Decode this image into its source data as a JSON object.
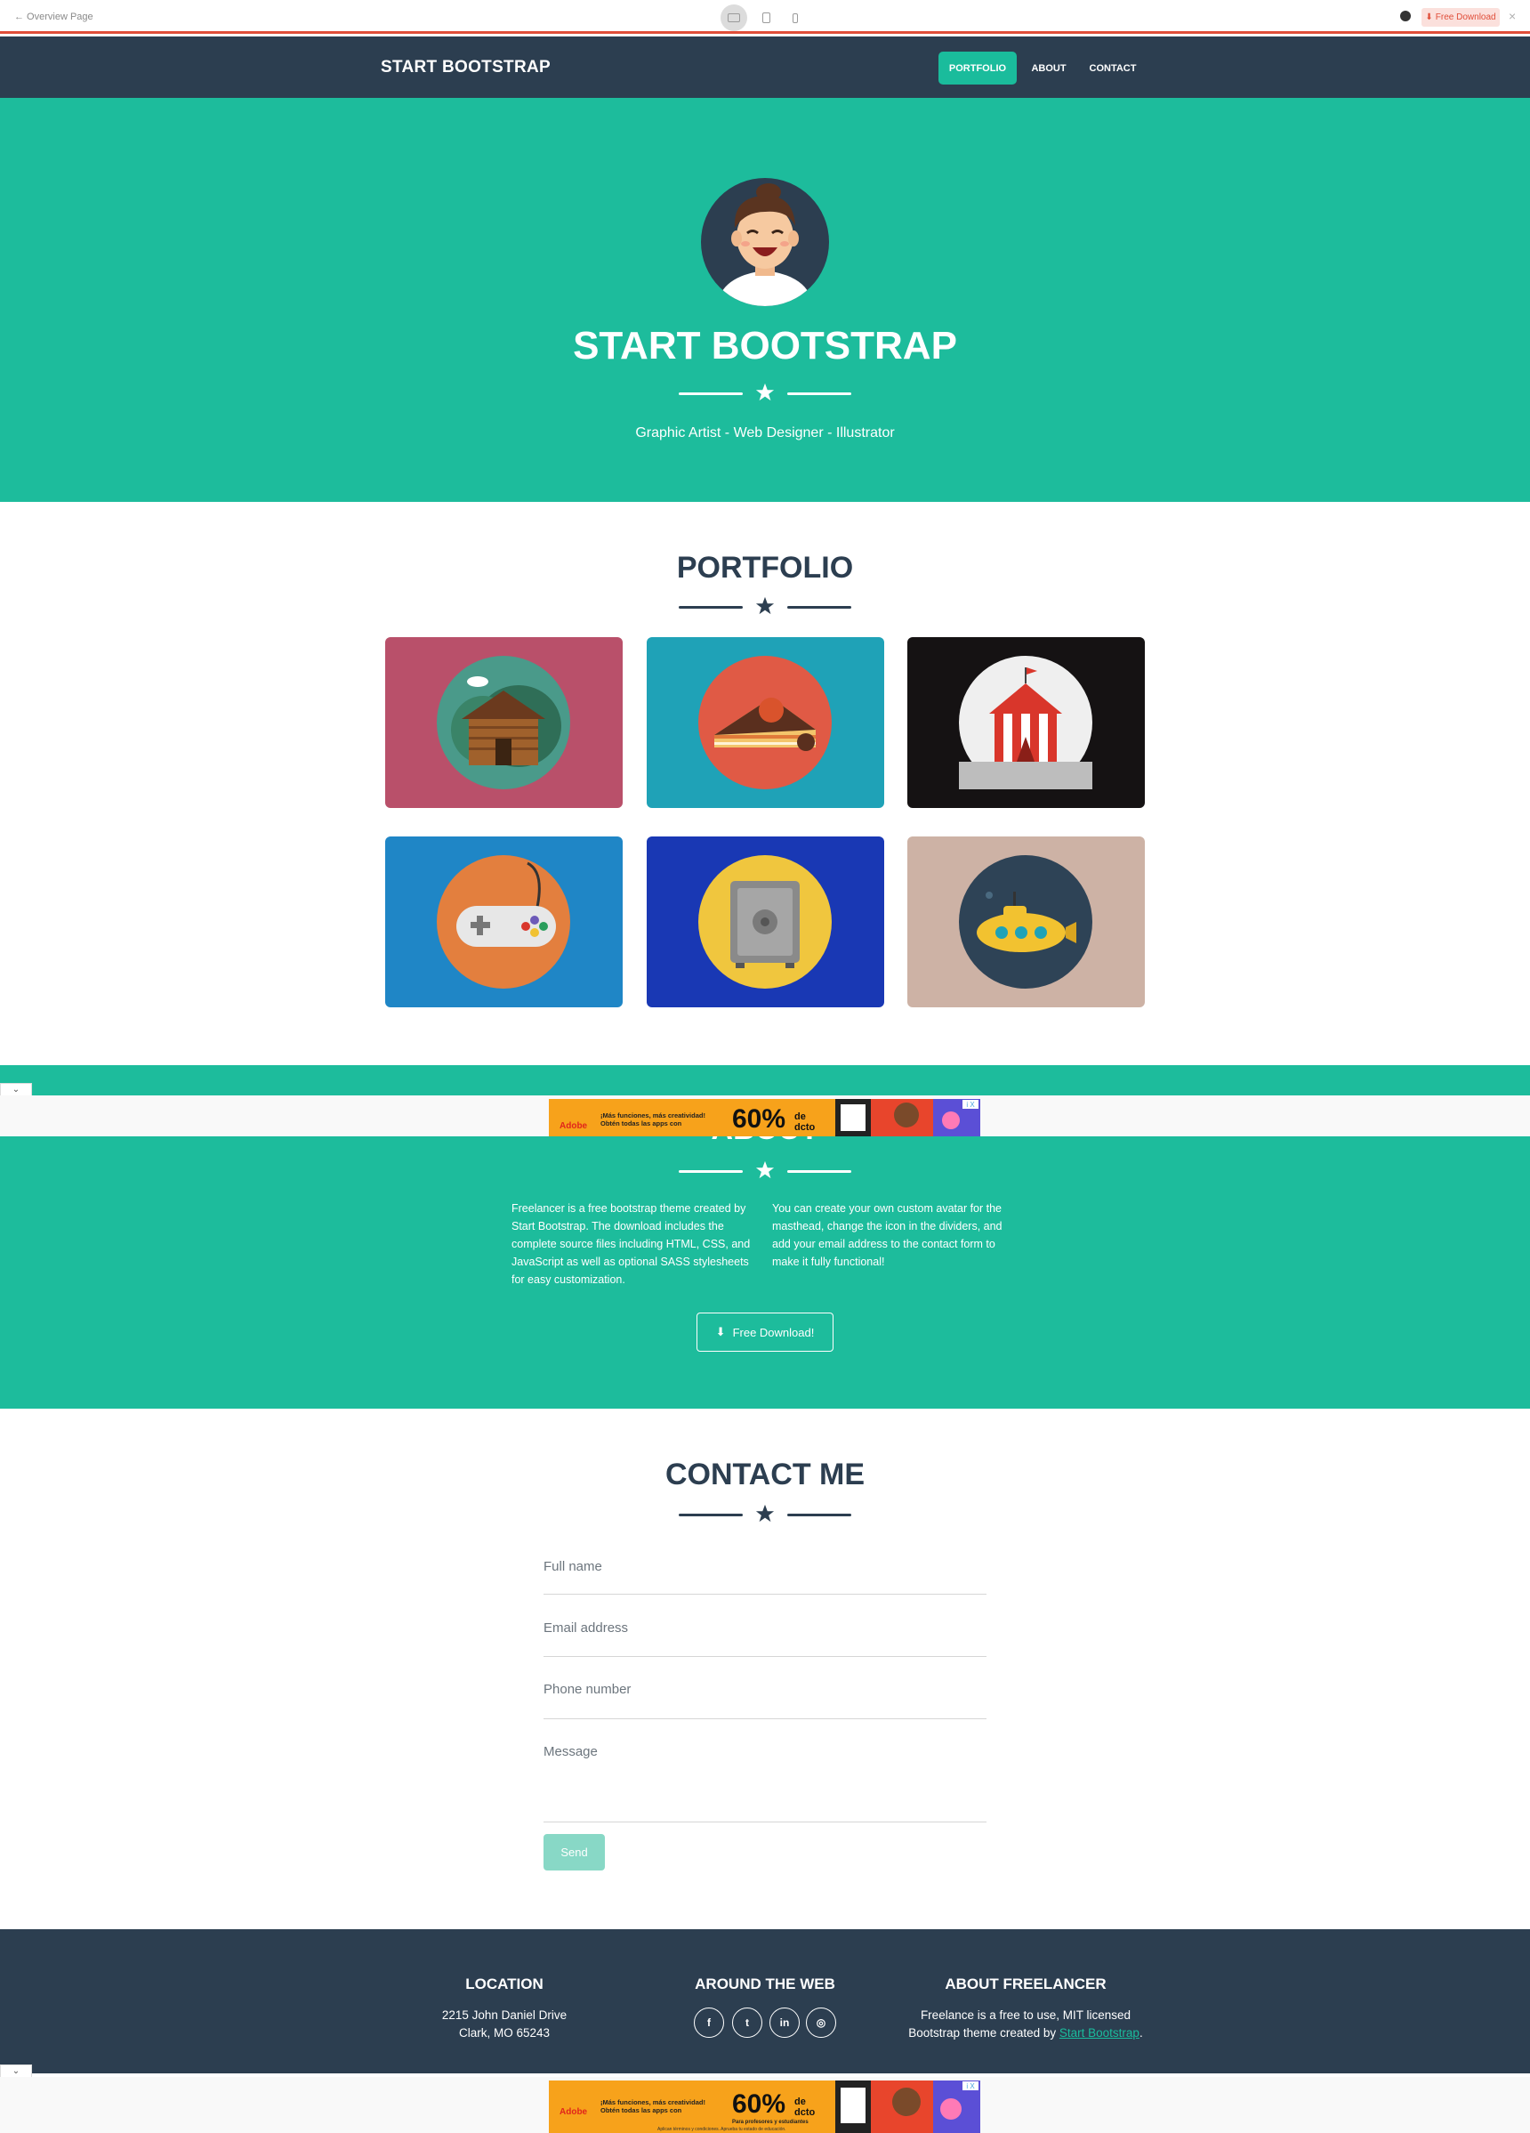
{
  "preview_bar": {
    "back_label": "← Overview Page",
    "download_label": "Free Download",
    "close_label": "×"
  },
  "navbar": {
    "brand": "START BOOTSTRAP",
    "items": [
      {
        "label": "PORTFOLIO",
        "active": true
      },
      {
        "label": "ABOUT",
        "active": false
      },
      {
        "label": "CONTACT",
        "active": false
      }
    ]
  },
  "masthead": {
    "title": "START BOOTSTRAP",
    "subtitle": "Graphic Artist - Web Designer - Illustrator"
  },
  "portfolio": {
    "title": "PORTFOLIO",
    "items": [
      {
        "name": "cabin",
        "bg": "#b9506a",
        "circle": "#4a9a8a"
      },
      {
        "name": "cake",
        "bg": "#1fa2b7",
        "circle": "#e05a45"
      },
      {
        "name": "circus",
        "bg": "#151213",
        "circle": "#efefef"
      },
      {
        "name": "game",
        "bg": "#1f86c6",
        "circle": "#e37f3e"
      },
      {
        "name": "safe",
        "bg": "#1938b4",
        "circle": "#f0c63e"
      },
      {
        "name": "submarine",
        "bg": "#cdb2a5",
        "circle": "#2e4356"
      }
    ]
  },
  "about": {
    "title": "ABOUT",
    "left_text": "Freelancer is a free bootstrap theme created by Start Bootstrap. The download includes the complete source files including HTML, CSS, and JavaScript as well as optional SASS stylesheets for easy customization.",
    "right_text": "You can create your own custom avatar for the masthead, change the icon in the dividers, and add your email address to the contact form to make it fully functional!",
    "button_label": "Free Download!"
  },
  "ad": {
    "brand": "Adobe",
    "line1": "¡Más funciones, más creatividad!",
    "line2": "Obtén todas las apps con",
    "percent": "60%",
    "percent_sub1": "de",
    "percent_sub2": "dcto",
    "bottom_sub": "Para profesores y estudiantes",
    "fine_print": "Aplican términos y condiciones. Aprueba tu estado de educación.",
    "close_label": "i X"
  },
  "contact": {
    "title": "CONTACT ME",
    "fields": [
      {
        "placeholder": "Full name"
      },
      {
        "placeholder": "Email address"
      },
      {
        "placeholder": "Phone number"
      },
      {
        "placeholder": "Message"
      }
    ],
    "send_label": "Send"
  },
  "footer": {
    "location": {
      "title": "LOCATION",
      "line1": "2215 John Daniel Drive",
      "line2": "Clark, MO 65243"
    },
    "web": {
      "title": "AROUND THE WEB",
      "icons": [
        "facebook-icon",
        "twitter-icon",
        "linkedin-icon",
        "dribbble-icon"
      ],
      "glyphs": [
        "f",
        "t",
        "in",
        "◎"
      ]
    },
    "about": {
      "title": "ABOUT FREELANCER",
      "line1": "Freelance is a free to use, MIT licensed",
      "line2_prefix": "Bootstrap theme created by",
      "link": "Start Bootstrap",
      "suffix": "."
    }
  },
  "colors": {
    "primary": "#1abc9c",
    "secondary": "#2c3e50",
    "preview_accent": "#e04e39"
  }
}
